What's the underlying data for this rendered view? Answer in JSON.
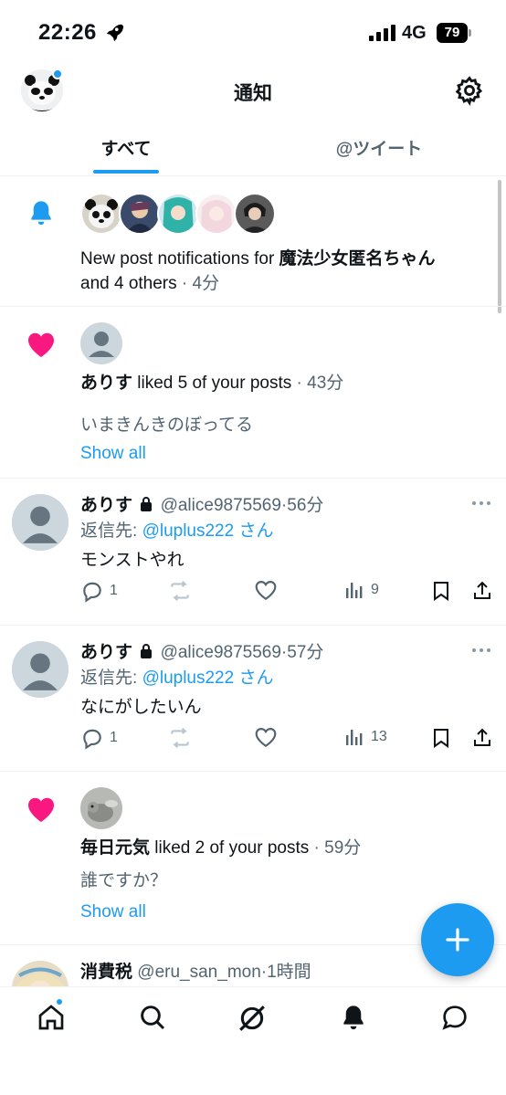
{
  "status_bar": {
    "time": "22:26",
    "network": "4G",
    "battery": "79"
  },
  "header": {
    "title": "通知"
  },
  "tabs": [
    {
      "label": "すべて",
      "selected": true
    },
    {
      "label": "@ツイート",
      "selected": false
    }
  ],
  "notifications": [
    {
      "type": "new-post",
      "text_pre": "New post notifications for ",
      "name": "魔法少女匿名ちゃん",
      "text_post": "and 4 others",
      "time": "· 4分"
    },
    {
      "type": "like",
      "name": "ありす",
      "text": " liked 5 of your posts",
      "time": " · 43分",
      "preview": "いまきんきのぼってる",
      "show_all": "Show all"
    },
    {
      "type": "reply",
      "name": "ありす",
      "handle": "@alice9875569",
      "time": "·56分",
      "reply_prefix": "返信先: ",
      "reply_target": "@luplus222 さん",
      "body": "モンストやれ",
      "replies": "1",
      "views": "9"
    },
    {
      "type": "reply",
      "name": "ありす",
      "handle": "@alice9875569",
      "time": "·57分",
      "reply_prefix": "返信先: ",
      "reply_target": "@luplus222 さん",
      "body": "なにがしたいん",
      "replies": "1",
      "views": "13"
    },
    {
      "type": "like",
      "name": "毎日元気",
      "text": " liked 2 of your posts",
      "time": " · 59分",
      "preview": "誰ですか？",
      "show_all": "Show all"
    },
    {
      "type": "post",
      "name": "消費税",
      "handle": "@eru_san_mon",
      "time": "·1時間"
    }
  ],
  "colors": {
    "accent": "#1d9bf0",
    "like": "#f91880",
    "text": "#0f1419",
    "secondary": "#536471"
  }
}
